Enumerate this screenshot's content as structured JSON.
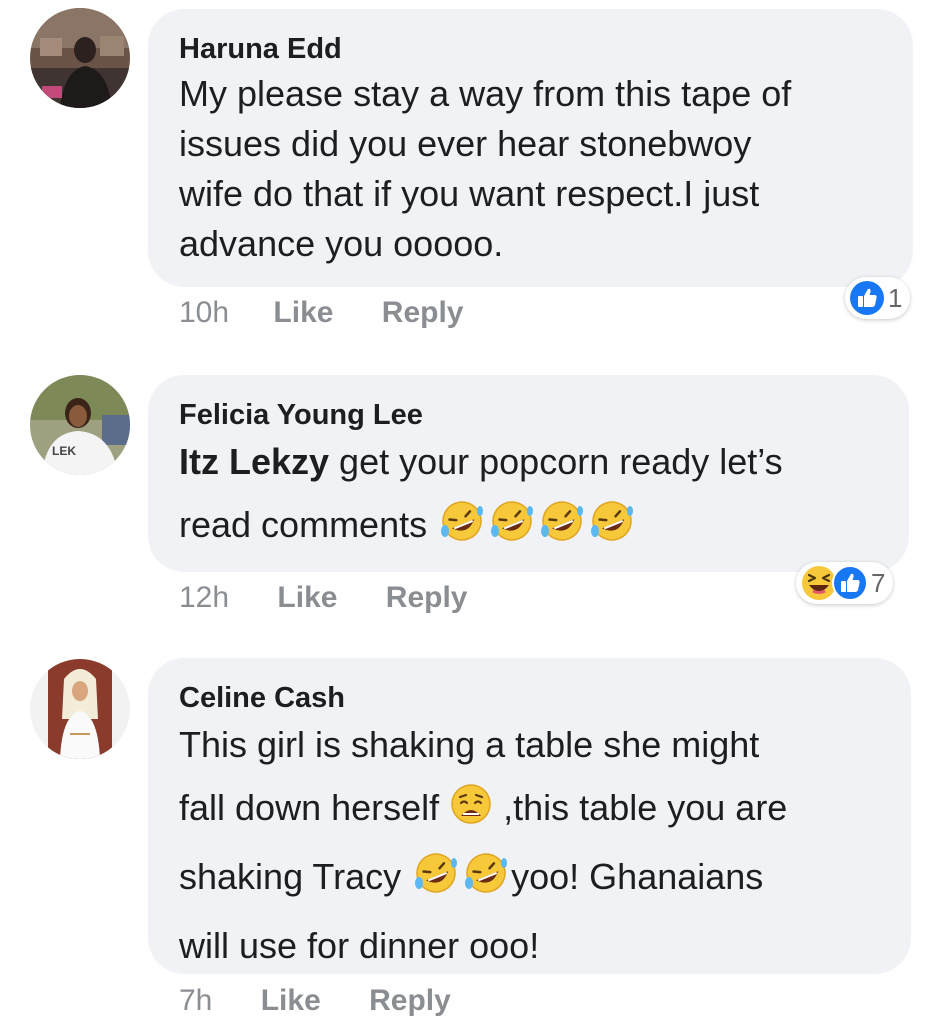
{
  "comments": [
    {
      "author": "Haruna Edd",
      "lines": [
        "My please stay a way from this tape of",
        "issues did you ever hear stonebwoy",
        "wife do that if you want respect.I just",
        "advance you ooooo."
      ],
      "time": "10h",
      "like_label": "Like",
      "reply_label": "Reply",
      "reactions": [
        "like"
      ],
      "reaction_count": "1"
    },
    {
      "author": "Felicia Young Lee",
      "mention": "Itz Lekzy",
      "line1_rest": " get your popcorn ready let’s",
      "line2": "read comments",
      "time": "12h",
      "like_label": "Like",
      "reply_label": "Reply",
      "reactions": [
        "haha",
        "like"
      ],
      "reaction_count": "7"
    },
    {
      "author": "Celine Cash",
      "line1": "This girl is shaking a table she might",
      "line2a": "fall down herself",
      "line2b": " ,this table you are",
      "line3a": "shaking Tracy",
      "line3b": "yoo! Ghanaians",
      "line4": "will use for dinner ooo!",
      "time": "7h",
      "like_label": "Like",
      "reply_label": "Reply"
    }
  ],
  "colors": {
    "bubble": "#f0f2f5",
    "meta": "#8a8d91",
    "like_blue": "#1877f2",
    "emoji_yellow": "#f7c83a"
  },
  "avatar_descriptions": {
    "haruna": "man-seated-photo",
    "felicia": "woman-white-shirt-photo",
    "celine": "blonde-woman-white-dress-photo"
  }
}
